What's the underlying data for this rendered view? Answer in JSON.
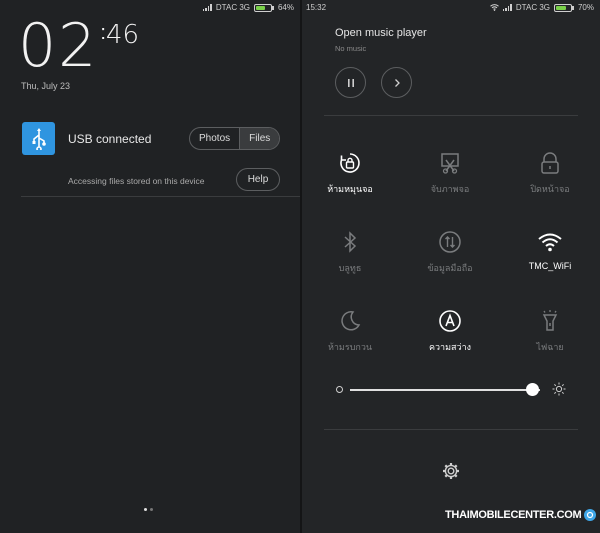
{
  "left": {
    "status": {
      "carrier": "DTAC 3G",
      "battery": "64%",
      "battery_level": 0.64
    },
    "lock_clock": {
      "hour": "02",
      "minute": "46",
      "date": "Thu, July 23"
    },
    "notification": {
      "title": "USB connected",
      "subtitle": "Accessing files stored on this device",
      "options": [
        "Photos",
        "Files"
      ],
      "selected": "Files",
      "help_label": "Help",
      "icon": "usb-icon"
    },
    "pager": {
      "pages": 2,
      "current": 1
    }
  },
  "right": {
    "status": {
      "time": "15:32",
      "carrier": "DTAC 3G",
      "battery": "70%",
      "battery_level": 0.7
    },
    "music": {
      "title": "Open music player",
      "subtitle": "No music"
    },
    "tiles": [
      {
        "label": "ห้ามหมุนจอ",
        "icon": "rotation-lock-icon",
        "active": true
      },
      {
        "label": "จับภาพจอ",
        "icon": "screenshot-icon",
        "active": false
      },
      {
        "label": "ปิดหน้าจอ",
        "icon": "lock-icon",
        "active": false
      },
      {
        "label": "บลูทูธ",
        "icon": "bluetooth-icon",
        "active": false
      },
      {
        "label": "ข้อมูลมือถือ",
        "icon": "mobile-data-icon",
        "active": false
      },
      {
        "label": "TMC_WiFi",
        "icon": "wifi-icon",
        "active": true
      },
      {
        "label": "ห้ามรบกวน",
        "icon": "moon-icon",
        "active": false
      },
      {
        "label": "ความสว่าง",
        "icon": "auto-brightness-icon",
        "active": true
      },
      {
        "label": "ไฟฉาย",
        "icon": "flashlight-icon",
        "active": false
      }
    ],
    "brightness": {
      "level": 0.96
    },
    "watermark": "THAIMOBILECENTER.COM"
  },
  "colors": {
    "accent_usb": "#2f95e0",
    "battery_fill": "#7ad14a",
    "background": "#202224"
  }
}
